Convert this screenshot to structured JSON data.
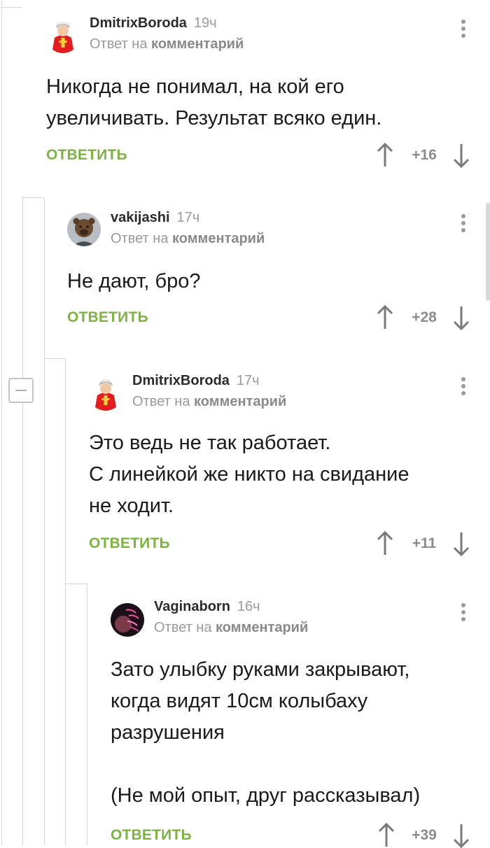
{
  "comments": [
    {
      "author": "DmitrixBoroda",
      "time": "19ч",
      "reply_prefix": "Ответ на",
      "reply_target": "комментарий",
      "text": "Никогда не понимал, на кой его\nувеличивать. Результат всяко един.",
      "reply_label": "ОТВЕТИТЬ",
      "score": "+16",
      "avatar_icon": "pope-avatar-icon"
    },
    {
      "author": "vakijashi",
      "time": "17ч",
      "reply_prefix": "Ответ на",
      "reply_target": "комментарий",
      "text": "Не дают, бро?",
      "reply_label": "ОТВЕТИТЬ",
      "score": "+28",
      "avatar_icon": "bear-avatar-icon"
    },
    {
      "author": "DmitrixBoroda",
      "time": "17ч",
      "reply_prefix": "Ответ на",
      "reply_target": "комментарий",
      "text": "Это ведь не так работает.\nС линейкой же никто на свидание\nне ходит.",
      "reply_label": "ОТВЕТИТЬ",
      "score": "+11",
      "avatar_icon": "pope-avatar-icon"
    },
    {
      "author": "Vaginaborn",
      "time": "16ч",
      "reply_prefix": "Ответ на",
      "reply_target": "комментарий",
      "text": "Зато улыбку руками закрывают,\nкогда видят 10см колыбаху\nразрушения\n\n(Не мой опыт, друг рассказывал)",
      "reply_label": "ОТВЕТИТЬ",
      "score": "+39",
      "avatar_icon": "neon-avatar-icon"
    }
  ],
  "colors": {
    "reply_green": "#7cb342",
    "muted_gray": "#9a9a9a",
    "thread_line": "#d6d6d6"
  }
}
